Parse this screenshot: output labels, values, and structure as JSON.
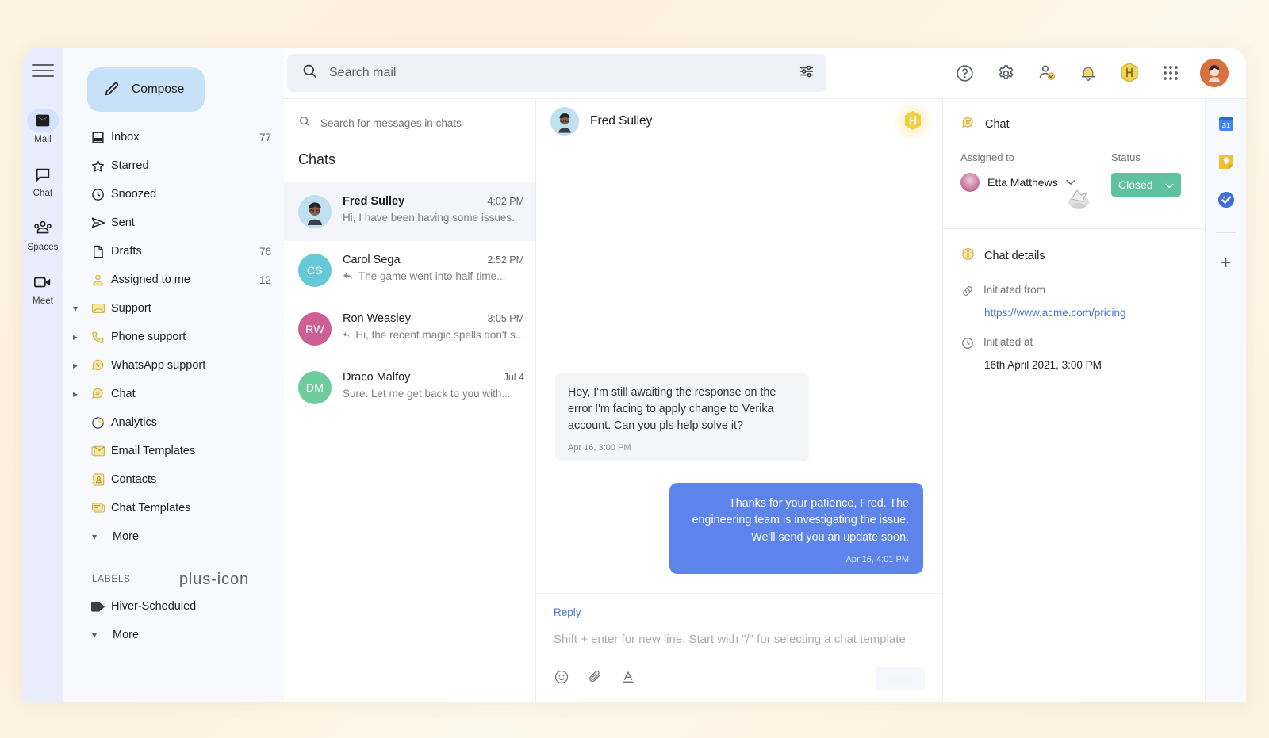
{
  "rail": {
    "menu_icon": "hamburger-icon",
    "items": [
      {
        "label": "Mail",
        "icon": "mail-icon",
        "active": true
      },
      {
        "label": "Chat",
        "icon": "chat-icon",
        "active": false
      },
      {
        "label": "Spaces",
        "icon": "spaces-icon",
        "active": false
      },
      {
        "label": "Meet",
        "icon": "meet-icon",
        "active": false
      }
    ]
  },
  "sidebar": {
    "compose_label": "Compose",
    "compose_icon": "pencil-icon",
    "items": [
      {
        "label": "Inbox",
        "count": "77",
        "icon": "inbox-icon",
        "arrow": ""
      },
      {
        "label": "Starred",
        "count": "",
        "icon": "star-icon",
        "arrow": ""
      },
      {
        "label": "Snoozed",
        "count": "",
        "icon": "clock-icon",
        "arrow": ""
      },
      {
        "label": "Sent",
        "count": "",
        "icon": "send-icon",
        "arrow": ""
      },
      {
        "label": "Drafts",
        "count": "76",
        "icon": "draft-icon",
        "arrow": ""
      },
      {
        "label": "Assigned to me",
        "count": "12",
        "icon": "person-icon",
        "arrow": ""
      },
      {
        "label": "Support",
        "count": "",
        "icon": "support-inbox-icon",
        "arrow": "down"
      },
      {
        "label": "Phone support",
        "count": "",
        "icon": "phone-icon",
        "arrow": "right"
      },
      {
        "label": "WhatsApp support",
        "count": "",
        "icon": "whatsapp-icon",
        "arrow": "right"
      },
      {
        "label": "Chat",
        "count": "",
        "icon": "chat-bubble-icon",
        "arrow": "right"
      },
      {
        "label": "Analytics",
        "count": "",
        "icon": "analytics-icon",
        "arrow": ""
      },
      {
        "label": "Email Templates",
        "count": "",
        "icon": "email-template-icon",
        "arrow": ""
      },
      {
        "label": "Contacts",
        "count": "",
        "icon": "contacts-icon",
        "arrow": ""
      },
      {
        "label": "Chat Templates",
        "count": "",
        "icon": "chat-template-icon",
        "arrow": ""
      }
    ],
    "more_label": "More",
    "labels_header": "LABELS",
    "add_label_icon": "plus-icon",
    "labels": [
      {
        "label": "Hiver-Scheduled",
        "icon": "tag-icon",
        "color": "#3c4043"
      }
    ],
    "labels_more": "More"
  },
  "search": {
    "placeholder": "Search mail",
    "search_icon": "search-icon",
    "filter_icon": "tune-filter-icon"
  },
  "header_icons": [
    {
      "name": "help-icon"
    },
    {
      "name": "settings-gear-icon"
    },
    {
      "name": "person-check-icon"
    },
    {
      "name": "bell-notification-icon"
    },
    {
      "name": "hiver-hexagon-icon"
    },
    {
      "name": "apps-grid-icon"
    }
  ],
  "chat_list": {
    "search_placeholder": "Search for messages in chats",
    "title": "Chats",
    "rows": [
      {
        "name": "Fred Sulley",
        "time": "4:02 PM",
        "preview": "Hi, I have been having some issues...",
        "initials": "",
        "color": "#bfe0ee",
        "replied": false,
        "selected": true
      },
      {
        "name": "Carol Sega",
        "time": "2:52 PM",
        "preview": "The game went into half-time...",
        "initials": "CS",
        "color": "#67c8d8",
        "replied": true,
        "selected": false
      },
      {
        "name": "Ron Weasley",
        "time": "3:05 PM",
        "preview": "Hi, the recent magic spells don't s...",
        "initials": "RW",
        "color": "#cc5f93",
        "replied": true,
        "selected": false
      },
      {
        "name": "Draco Malfoy",
        "time": "Jul 4",
        "preview": "Sure. Let me get back to you with...",
        "initials": "DM",
        "color": "#6ecb9c",
        "replied": false,
        "selected": false
      }
    ]
  },
  "conversation": {
    "contact_name": "Fred Sulley",
    "badge_icon": "hiver-hexagon-icon",
    "messages": [
      {
        "direction": "in",
        "text": "Hey, I'm still awaiting the response on the error I'm facing to apply change to Verika account. Can you pls help solve it?",
        "time": "Apr 16, 3:00 PM"
      },
      {
        "direction": "out",
        "text": "Thanks for your patience, Fred. The engineering team is investigating the issue. We'll send you an update soon.",
        "time": "Apr 16, 4:01 PM"
      }
    ],
    "composer": {
      "reply_label": "Reply",
      "placeholder": "Shift + enter for new line. Start with \"/\" for selecting a chat template",
      "emoji_icon": "emoji-icon",
      "attach_icon": "attachment-paperclip-icon",
      "format_icon": "text-format-icon",
      "send_label": "Send"
    }
  },
  "details": {
    "panel_title": "Chat",
    "panel_icon": "chat-bubble-icon",
    "assigned_label": "Assigned to",
    "assignee_name": "Etta Matthews",
    "status_label": "Status",
    "status_value": "Closed",
    "status_color": "#5ec2a0",
    "chat_details_label": "Chat details",
    "chat_details_icon": "info-icon",
    "initiated_from_label": "Initiated from",
    "initiated_from_icon": "link-icon",
    "initiated_from_url": "https://www.acme.com/pricing",
    "initiated_at_label": "Initiated at",
    "initiated_at_icon": "clock-icon",
    "initiated_at_value": "16th April 2021, 3:00 PM"
  },
  "addons": [
    {
      "name": "google-calendar-icon",
      "day": "31"
    },
    {
      "name": "google-keep-icon"
    },
    {
      "name": "google-tasks-icon"
    }
  ],
  "addon_plus": "+"
}
